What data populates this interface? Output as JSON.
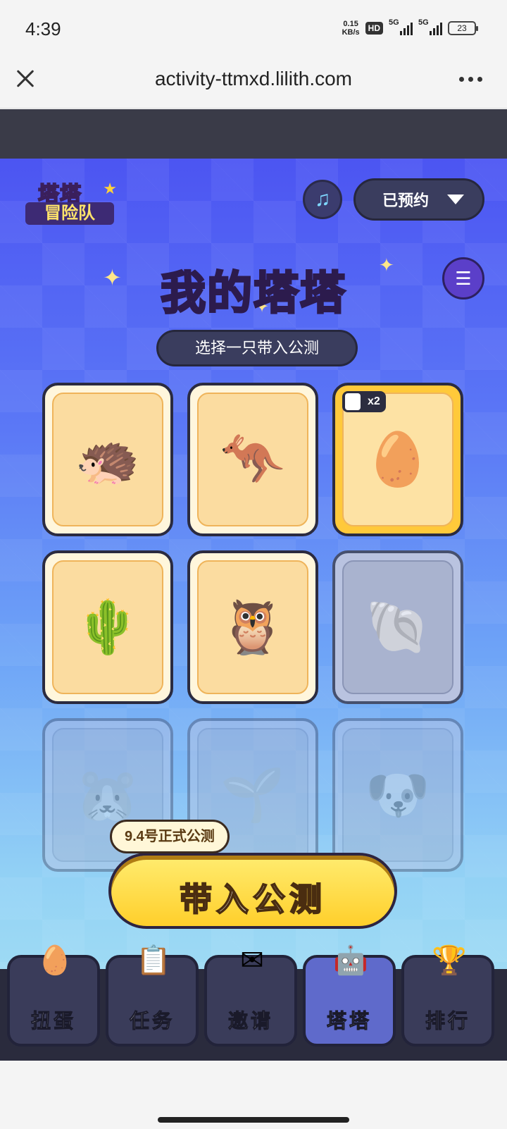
{
  "status": {
    "time": "4:39",
    "net_speed_value": "0.15",
    "net_speed_unit": "KB/s",
    "hd": "HD",
    "signal1": "5G",
    "signal2": "5G",
    "battery": "23"
  },
  "browser": {
    "url": "activity-ttmxd.lilith.com"
  },
  "header": {
    "logo_line1": "塔塔",
    "logo_line2": "冒险队",
    "reserve_label": "已预约"
  },
  "page": {
    "title": "我的塔塔",
    "subtitle": "选择一只带入公测"
  },
  "cards": [
    {
      "name": "hedgehog",
      "state": "owned",
      "emoji": "🦔"
    },
    {
      "name": "kangaroo",
      "state": "owned",
      "emoji": "🦘"
    },
    {
      "name": "star-egg",
      "state": "selected",
      "emoji": "🥚",
      "badge": "x2"
    },
    {
      "name": "cactus",
      "state": "owned",
      "emoji": "🌵"
    },
    {
      "name": "bird",
      "state": "owned",
      "emoji": "🦉"
    },
    {
      "name": "shell-crab",
      "state": "locked",
      "emoji": "🐚"
    },
    {
      "name": "hamster",
      "state": "locked",
      "emoji": "🐹"
    },
    {
      "name": "sprout",
      "state": "locked",
      "emoji": "🌱"
    },
    {
      "name": "dog",
      "state": "locked",
      "emoji": "🐶"
    }
  ],
  "cta": {
    "date_label": "9.4号正式公测",
    "button_label": "带入公测"
  },
  "nav": [
    {
      "label": "扭蛋",
      "icon": "gacha-egg-icon",
      "glyph": "🥚",
      "active": false
    },
    {
      "label": "任务",
      "icon": "task-clipboard-icon",
      "glyph": "📋",
      "active": false
    },
    {
      "label": "邀请",
      "icon": "invite-envelope-icon",
      "glyph": "✉",
      "active": false
    },
    {
      "label": "塔塔",
      "icon": "tata-robot-icon",
      "glyph": "🤖",
      "active": true
    },
    {
      "label": "排行",
      "icon": "trophy-icon",
      "glyph": "🏆",
      "active": false
    }
  ],
  "colors": {
    "bg_top": "#4c55f2",
    "bg_bottom": "#a9e3f2",
    "accent_yellow": "#ffd23a",
    "dark_ui": "#3a3d5e"
  }
}
